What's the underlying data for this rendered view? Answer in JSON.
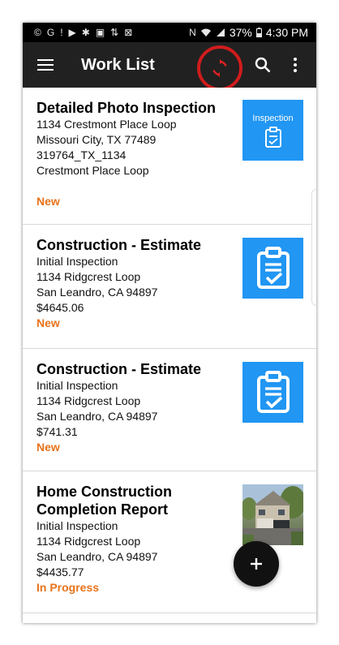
{
  "status_bar": {
    "left_icons": [
      "©",
      "G",
      "!",
      "▶",
      "✱",
      "▣",
      "⇅",
      "⊠"
    ],
    "nfc": "N",
    "battery_pct": "37%",
    "time": "4:30 PM"
  },
  "app_bar": {
    "title": "Work List",
    "menu_icon": "hamburger-menu",
    "sync_icon": "sync-icon",
    "search_icon": "search-icon",
    "more_icon": "more-vert-icon",
    "accent_sync": "#d01c1c"
  },
  "work_items": [
    {
      "title": "Detailed Photo Inspection",
      "lines": [
        "1134 Crestmont Place Loop",
        "Missouri City, TX 77489",
        "319764_TX_1134",
        "Crestmont Place  Loop"
      ],
      "status": "New",
      "thumb_type": "inspection",
      "thumb_label": "Inspection"
    },
    {
      "title": "Construction - Estimate",
      "lines": [
        "Initial Inspection",
        "1134 Ridgcrest Loop",
        "San Leandro, CA 94897",
        "$4645.06"
      ],
      "status": "New",
      "thumb_type": "clipboard"
    },
    {
      "title": "Construction - Estimate",
      "lines": [
        "Initial Inspection",
        "1134 Ridgcrest Loop",
        "San Leandro, CA 94897",
        "$741.31"
      ],
      "status": "New",
      "thumb_type": "clipboard"
    },
    {
      "title": "Home Construction Completion Report",
      "lines": [
        "Initial Inspection",
        "1134 Ridgcrest Loop",
        "San Leandro, CA 94897",
        "$4435.77"
      ],
      "status": "In Progress",
      "thumb_type": "photo"
    }
  ],
  "fab": {
    "label": "+",
    "icon": "add-icon"
  },
  "colors": {
    "status_orange": "#e8731a",
    "thumb_blue": "#2196f3",
    "app_bar_bg": "#212121"
  }
}
